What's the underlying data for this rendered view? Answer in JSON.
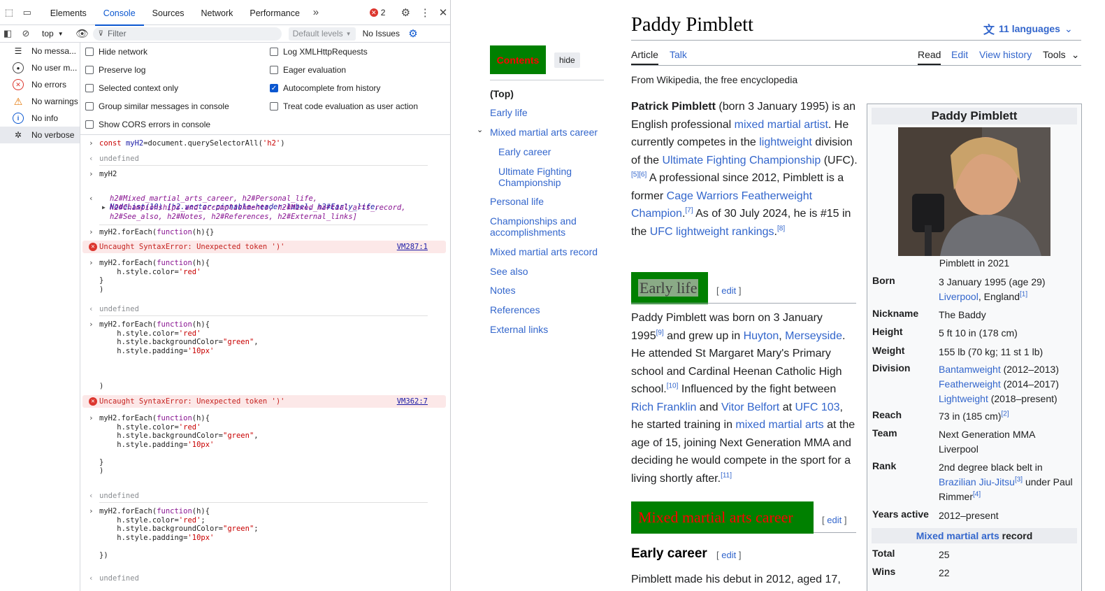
{
  "devtools": {
    "tabs": [
      "Elements",
      "Console",
      "Sources",
      "Network",
      "Performance"
    ],
    "error_count": "2",
    "context": "top",
    "filter_placeholder": "Filter",
    "levels": "Default levels",
    "issues": "No Issues",
    "sidebar": [
      "No messa...",
      "No user m...",
      "No errors",
      "No warnings",
      "No info",
      "No verbose"
    ],
    "settings": [
      {
        "label": "Hide network",
        "checked": false
      },
      {
        "label": "Preserve log",
        "checked": false
      },
      {
        "label": "Selected context only",
        "checked": false
      },
      {
        "label": "Group similar messages in console",
        "checked": false
      },
      {
        "label": "Show CORS errors in console",
        "checked": false
      },
      {
        "label": "Log XMLHttpRequests",
        "checked": false
      },
      {
        "label": "Eager evaluation",
        "checked": false
      },
      {
        "label": "Autocomplete from history",
        "checked": true
      },
      {
        "label": "Treat code evaluation as user action",
        "checked": false
      }
    ],
    "console": {
      "undefined": "undefined",
      "myH2": "myH2",
      "nodelist_1": "NodeList(10) [h2.vector-pinnable-header-label, h2#Early_life,",
      "nodelist_2": "h2#Mixed_martial_arts_career, h2#Personal_life,",
      "nodelist_3": "h2#Championships_and_accomplishments, h2#Mixed_martial_arts_record,",
      "nodelist_4": "h2#See_also, h2#Notes, h2#References, h2#External_links]",
      "error": "Uncaught SyntaxError: Unexpected token ')'",
      "error_link_1": "VM287:1",
      "error_link_2": "VM362:7"
    }
  },
  "wiki": {
    "title": "Paddy Pimblett",
    "languages": "11 languages",
    "tabs_left": [
      "Article",
      "Talk"
    ],
    "tabs_right": [
      "Read",
      "Edit",
      "View history",
      "Tools"
    ],
    "from": "From Wikipedia, the free encyclopedia",
    "contents_label": "Contents",
    "hide": "hide",
    "toc": [
      "(Top)",
      "Early life",
      "Mixed martial arts career",
      "Early career",
      "Ultimate Fighting Championship",
      "Personal life",
      "Championships and accomplishments",
      "Mixed martial arts record",
      "See also",
      "Notes",
      "References",
      "External links"
    ],
    "early_life": "Early life",
    "mma_career": "Mixed martial arts career",
    "early_career": "Early career",
    "edit": "edit",
    "early_career_text": "Pimblett made his debut in 2012, aged 17,",
    "infobox": {
      "title": "Paddy Pimblett",
      "caption": "Pimblett in 2021",
      "born_label": "Born",
      "born_1": "3 January 1995 (age 29)",
      "born_2a": "Liverpool",
      "born_2b": ", England",
      "nickname_label": "Nickname",
      "nickname": "The Baddy",
      "height_label": "Height",
      "height": "5 ft 10 in (178 cm)",
      "weight_label": "Weight",
      "weight": "155 lb (70 kg; 11 st 1 lb)",
      "division_label": "Division",
      "div_1a": "Bantamweight",
      "div_1b": " (2012–2013)",
      "div_2a": "Featherweight",
      "div_2b": " (2014–2017)",
      "div_3a": "Lightweight",
      "div_3b": " (2018–present)",
      "reach_label": "Reach",
      "reach": "73 in (185 cm)",
      "team_label": "Team",
      "team": "Next Generation MMA Liverpool",
      "rank_label": "Rank",
      "rank_1": "2nd degree black belt in",
      "rank_2": "Brazilian Jiu-Jitsu",
      "rank_3": " under Paul",
      "rank_4": "Rimmer",
      "years_label": "Years active",
      "years": "2012–present",
      "record_head_link": "Mixed martial arts",
      "record_head": " record",
      "total_label": "Total",
      "total": "25",
      "wins_label": "Wins",
      "wins": "22"
    }
  }
}
